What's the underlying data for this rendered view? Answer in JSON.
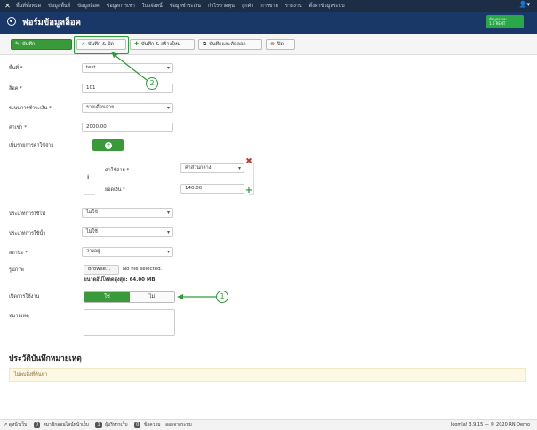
{
  "topnav": {
    "menu": [
      "พื้นที่ทั้งหมด",
      "ข้อมูลพื้นที่",
      "ข้อมูลล็อค",
      "ข้อมูลการเช่า",
      "ใบแจ้งหนี้",
      "ข้อมูลชำระเงิน",
      "กำไรขาดทุน",
      "ลูกค้า",
      "การขาย",
      "รายงาน",
      "ตั้งค่าข้อมูลระบบ"
    ],
    "user_icon": "user-icon"
  },
  "titlebar": {
    "title": "ฟอร์มข้อมูลล็อค",
    "badge_line1": "ข้อมูลระบบ",
    "badge_line2": "1.0 RENT"
  },
  "toolbar": {
    "save": "บันทึก",
    "save_close": "บันทึก & ปิด",
    "save_new": "บันทึก & สร้างใหม่",
    "save_copy": "บันทึกและคัดลอก",
    "close": "ปิด"
  },
  "form": {
    "area_label": "พื้นที่ *",
    "area_value": "test",
    "lock_label": "ล็อค *",
    "lock_value": "101",
    "payment_label": "ระบบการชำระเงิน *",
    "payment_value": "รายเดือนจ่าย",
    "rent_label": "ค่าเช่า *",
    "rent_value": "2000.00",
    "extra_label": "เพิ่มรายการค่าใช้จ่าย",
    "expense_label": "ค่าใช้จ่าย *",
    "expense_value": "ค่าส่วนกลาง",
    "amount_label": "ยอดเงิน *",
    "amount_value": "140.00",
    "usage_type_label": "ประเภทการใช้ไฟ",
    "usage_type_value": "ไม่ใช้",
    "water_type_label": "ประเภทการใช้น้ำ",
    "water_type_value": "ไม่ใช้",
    "status_label": "สถานะ *",
    "status_value": "ว่างอยู่",
    "image_label": "รูปภาพ",
    "browse_btn": "Browse...",
    "no_file": "No file selected.",
    "max_size": "ขนาดอัปโหลดสูงสุด: 64.00 MB",
    "enable_label": "เปิดการใช้งาน",
    "toggle_yes": "ใช่",
    "toggle_no": "ไม่",
    "note_label": "หมายเหตุ"
  },
  "callouts": [
    "1",
    "2"
  ],
  "history": {
    "title": "ประวัติบันทึกหมายเหตุ",
    "empty": "ไม่พบสิ่งที่ค้นหา"
  },
  "footer": {
    "view_site": "ดูหน้าเว็บ",
    "visitors_count": "0",
    "visitors_label": "สมาชิกออนไลน์หน้าเว็บ",
    "admins_count": "1",
    "admins_label": "ผู้บริหารเว็บ",
    "messages_count": "0",
    "messages_label": "ข้อความ",
    "logout": "ออกจากระบบ",
    "version": "Joomla! 3.9.15 — © 2020 RN Demo"
  }
}
